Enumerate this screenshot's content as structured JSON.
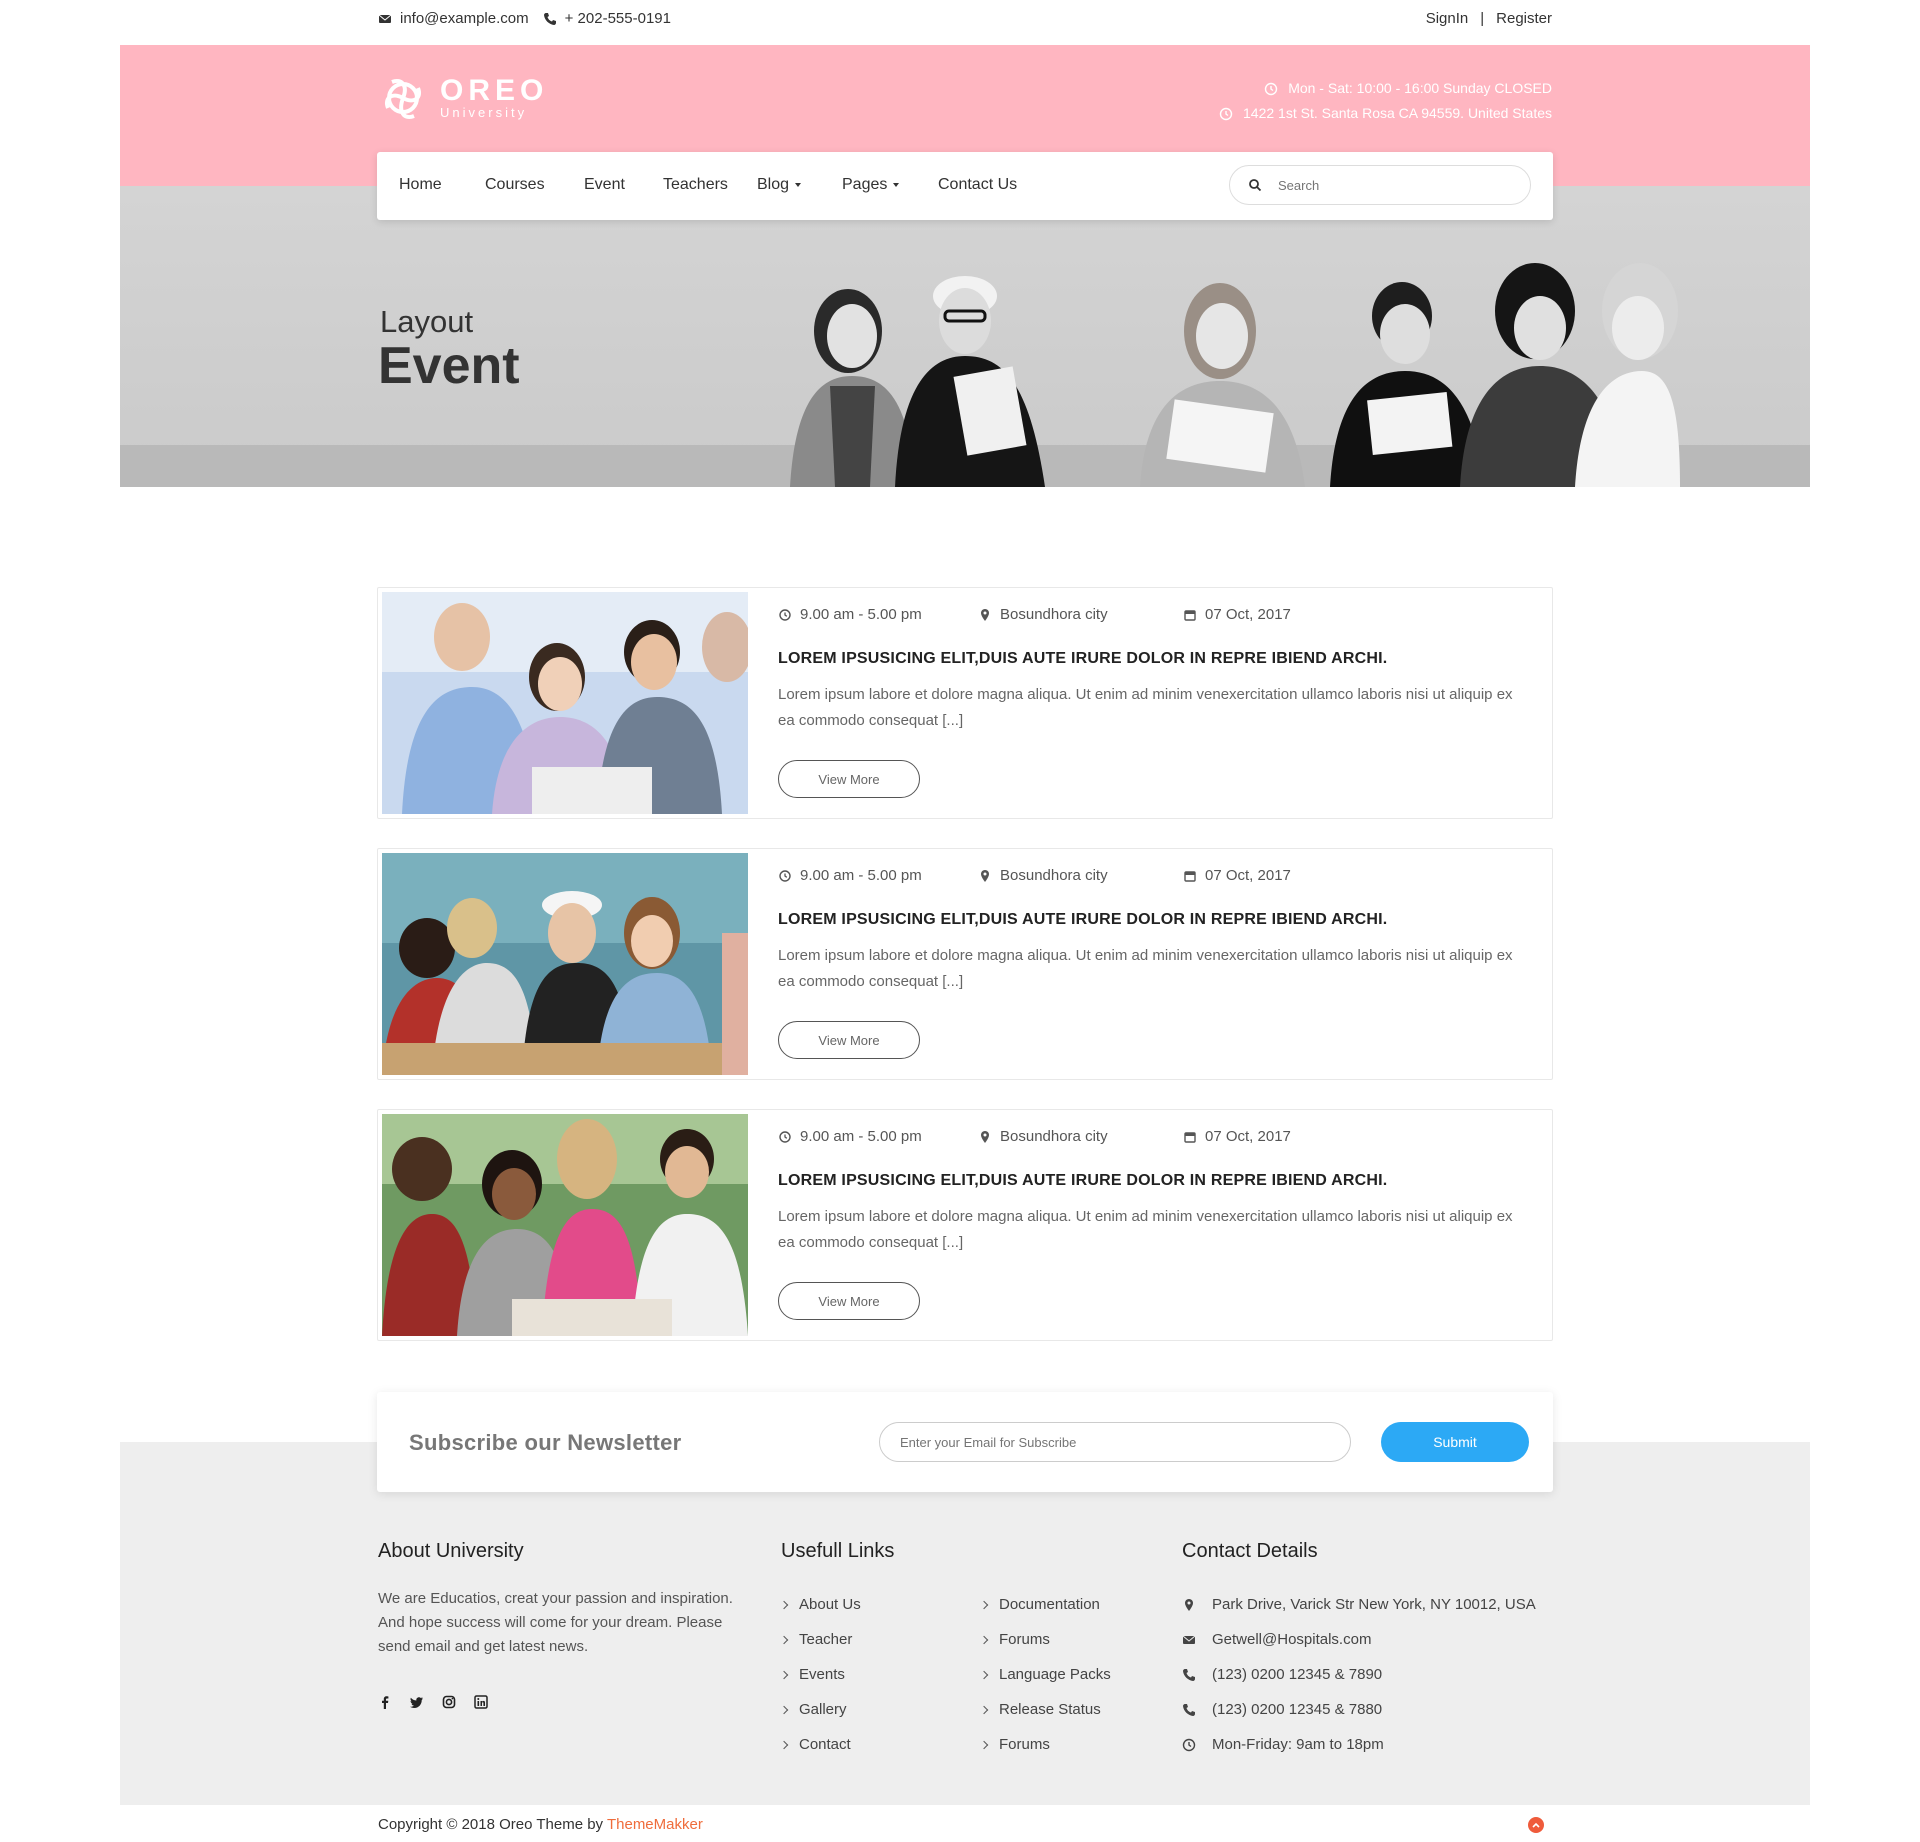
{
  "topbar": {
    "email": "info@example.com",
    "phone": "+ 202-555-0191",
    "signin": "SignIn",
    "separator": "|",
    "register": "Register"
  },
  "brand": {
    "name": "OREO",
    "tagline": "University",
    "hours": "Mon - Sat: 10:00 - 16:00 Sunday CLOSED",
    "address": "1422 1st St. Santa Rosa CA 94559. United States"
  },
  "nav": {
    "items": [
      {
        "label": "Home"
      },
      {
        "label": "Courses"
      },
      {
        "label": "Event"
      },
      {
        "label": "Teachers"
      },
      {
        "label": "Blog"
      },
      {
        "label": "Pages"
      },
      {
        "label": "Contact Us"
      }
    ],
    "search_placeholder": "Search"
  },
  "hero": {
    "subtitle": "Layout",
    "title": "Event"
  },
  "events": [
    {
      "time": "9.00 am - 5.00 pm",
      "location": "Bosundhora city",
      "date": "07 Oct, 2017",
      "title": "LOREM IPSUSICING ELIT,DUIS AUTE IRURE DOLOR IN REPRE IBIEND ARCHI.",
      "description": "Lorem ipsum labore et dolore magna aliqua. Ut enim ad minim venexercitation ullamco laboris nisi ut aliquip ex ea commodo consequat [...]",
      "button": "View More"
    },
    {
      "time": "9.00 am - 5.00 pm",
      "location": "Bosundhora city",
      "date": "07 Oct, 2017",
      "title": "LOREM IPSUSICING ELIT,DUIS AUTE IRURE DOLOR IN REPRE IBIEND ARCHI.",
      "description": "Lorem ipsum labore et dolore magna aliqua. Ut enim ad minim venexercitation ullamco laboris nisi ut aliquip ex ea commodo consequat [...]",
      "button": "View More"
    },
    {
      "time": "9.00 am - 5.00 pm",
      "location": "Bosundhora city",
      "date": "07 Oct, 2017",
      "title": "LOREM IPSUSICING ELIT,DUIS AUTE IRURE DOLOR IN REPRE IBIEND ARCHI.",
      "description": "Lorem ipsum labore et dolore magna aliqua. Ut enim ad minim venexercitation ullamco laboris nisi ut aliquip ex ea commodo consequat [...]",
      "button": "View More"
    }
  ],
  "newsletter": {
    "heading": "Subscribe our Newsletter",
    "placeholder": "Enter your Email for Subscribe",
    "submit": "Submit"
  },
  "footer": {
    "about_heading": "About University",
    "about_text": "We are Educatios, creat your passion and inspiration. And hope success will come for your dream. Please send email and get latest news.",
    "social_icons": [
      "facebook-icon",
      "twitter-icon",
      "instagram-icon",
      "linkedin-icon"
    ],
    "links_heading": "Usefull Links",
    "links_col1": [
      "About Us",
      "Teacher",
      "Events",
      "Gallery",
      "Contact"
    ],
    "links_col2": [
      "Documentation",
      "Forums",
      "Language Packs",
      "Release Status",
      "Forums"
    ],
    "contact_heading": "Contact Details",
    "contact": [
      {
        "icon": "map-pin-icon",
        "text": "Park Drive, Varick Str New York, NY 10012, USA"
      },
      {
        "icon": "envelope-icon",
        "text": "Getwell@Hospitals.com"
      },
      {
        "icon": "phone-icon",
        "text": "(123) 0200 12345 & 7890"
      },
      {
        "icon": "phone-icon",
        "text": "(123) 0200 12345 & 7880"
      },
      {
        "icon": "clock-icon",
        "text": "Mon-Friday: 9am to 18pm"
      }
    ],
    "copyright": "Copyright © 2018 Oreo Theme by",
    "copyright_brand": "ThemeMakker"
  },
  "colors": {
    "header_pink": "#ffb6c1",
    "submit_blue": "#2ca9f5",
    "brand_orange": "#ef6c3b"
  }
}
